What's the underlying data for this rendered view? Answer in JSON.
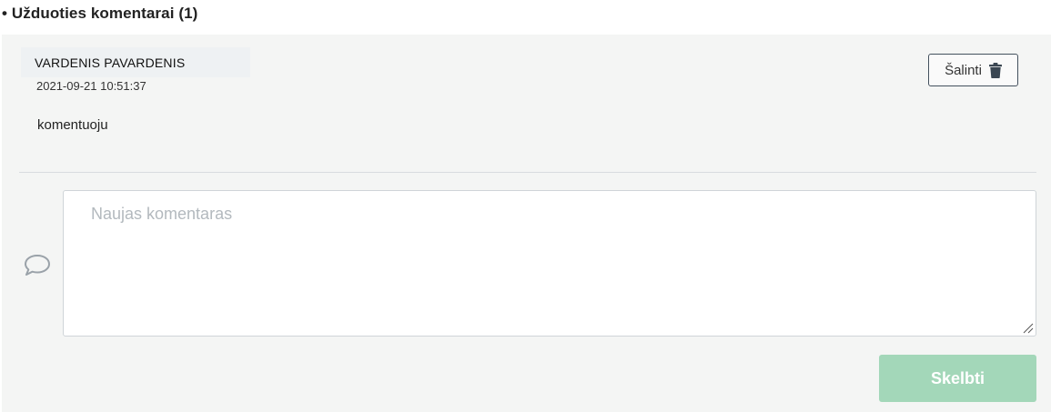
{
  "section": {
    "title": "• Užduoties komentarai (1)"
  },
  "comment": {
    "author": "VARDENIS PAVARDENIS",
    "date": "2021-09-21 10:51:37",
    "body": "komentuoju",
    "delete_label": "Šalinti",
    "delete_icon": "trash-icon"
  },
  "new_comment": {
    "placeholder": "Naujas komentaras",
    "value": "",
    "icon": "speech-bubble-icon",
    "submit_label": "Skelbti",
    "submit_color": "#a3d7b9"
  }
}
